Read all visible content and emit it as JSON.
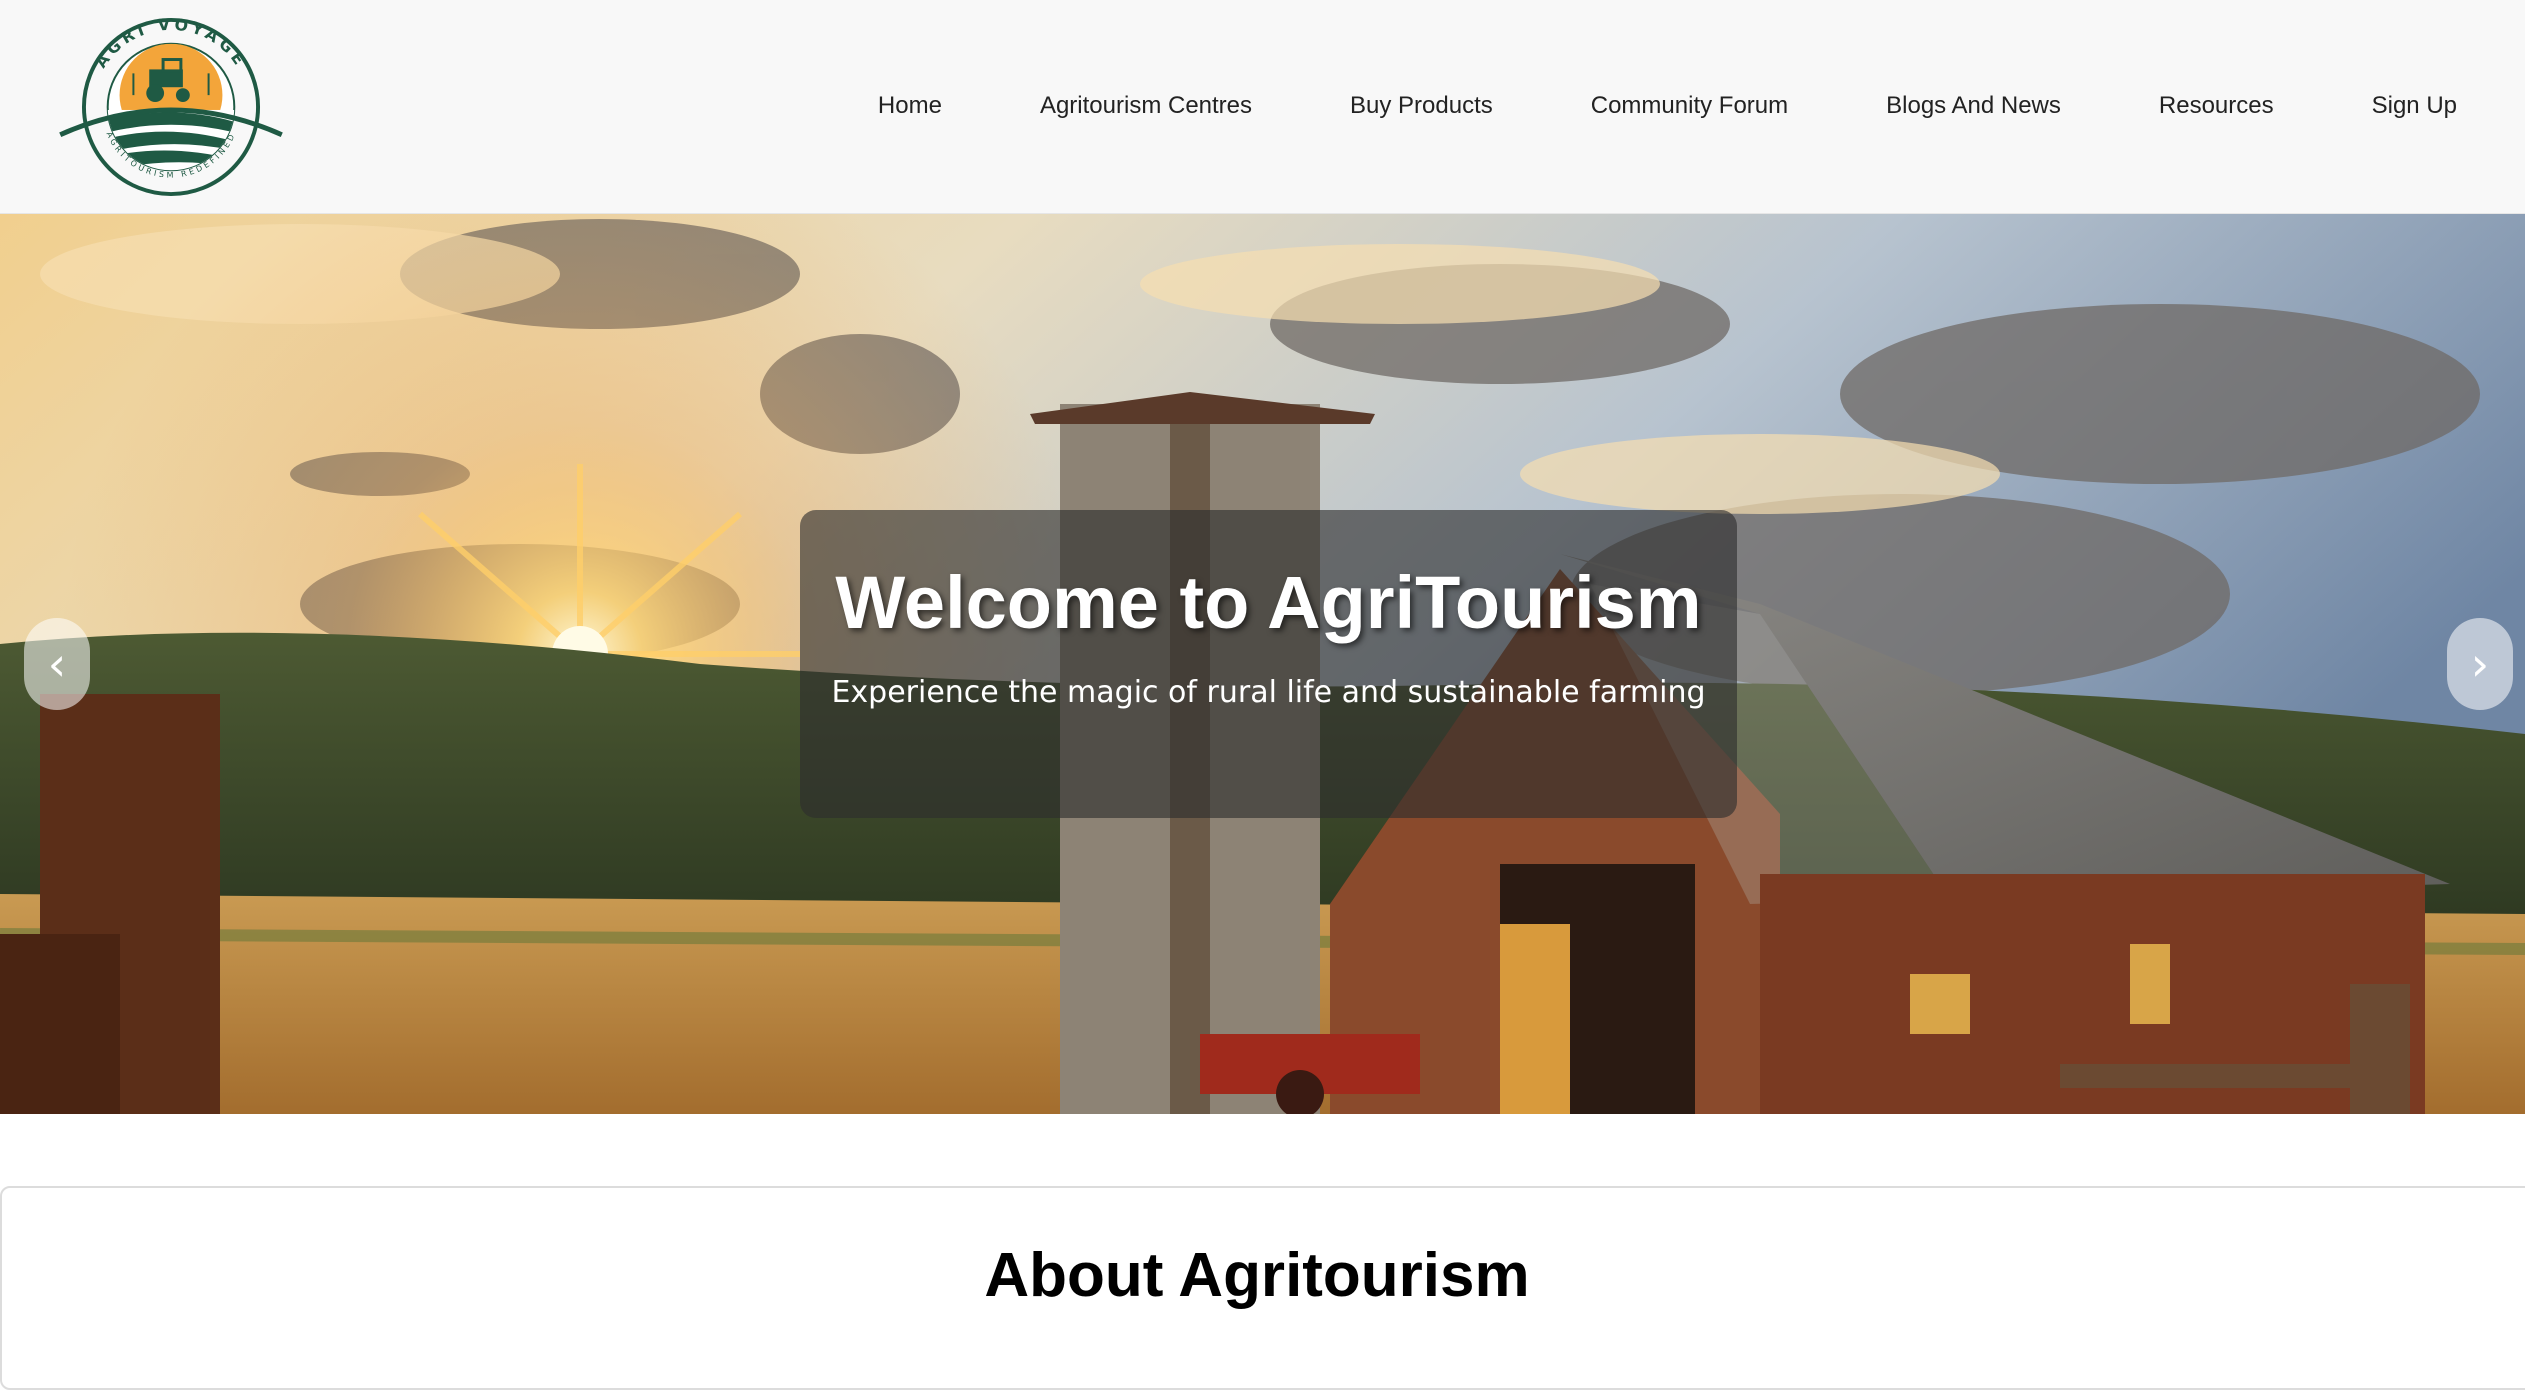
{
  "brand": {
    "logo_top_text": "AGRI VOYAGE",
    "logo_bottom_text": "AGRITOURISM REDEFINED"
  },
  "nav": {
    "items": [
      {
        "label": "Home"
      },
      {
        "label": "Agritourism Centres"
      },
      {
        "label": "Buy Products"
      },
      {
        "label": "Community Forum"
      },
      {
        "label": "Blogs And News"
      },
      {
        "label": "Resources"
      },
      {
        "label": "Sign Up"
      }
    ]
  },
  "hero": {
    "title": "Welcome to AgriTourism",
    "subtitle": "Experience the magic of rural life and sustainable farming",
    "prev_icon": "‹",
    "next_icon": "›"
  },
  "about": {
    "title": "About Agritourism"
  },
  "colors": {
    "brand_green": "#1f5a44",
    "logo_sun": "#f3a53a",
    "header_bg": "#f8f8f8",
    "caption_bg": "rgba(45,45,45,0.62)"
  }
}
